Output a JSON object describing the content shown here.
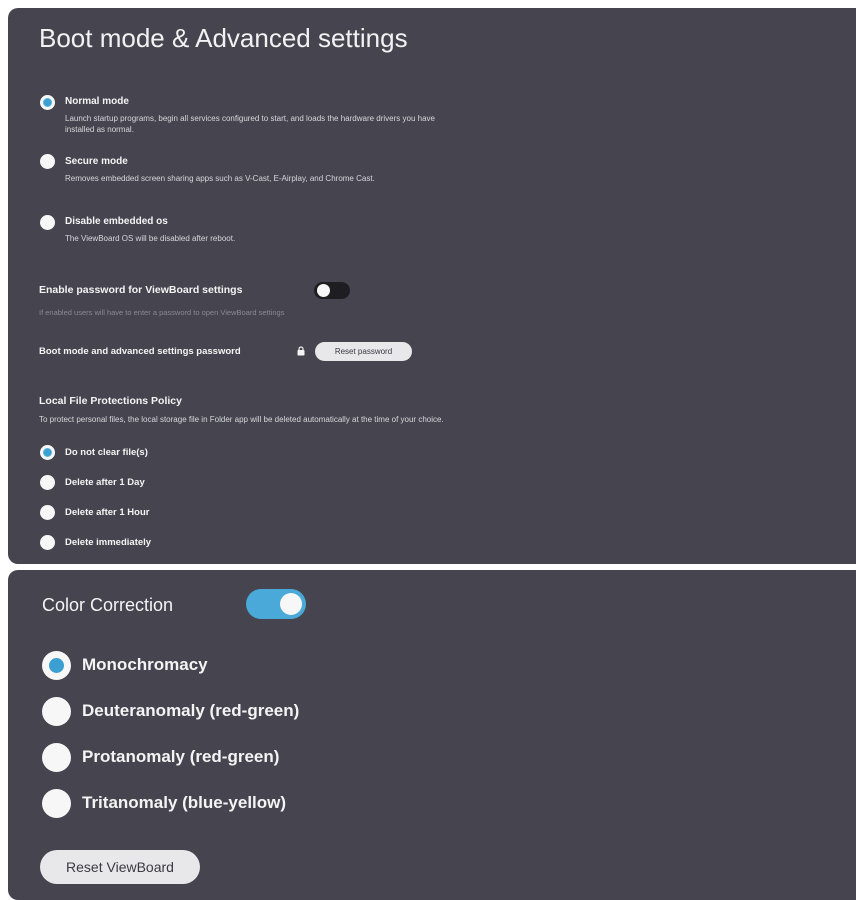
{
  "boot_panel": {
    "title": "Boot mode & Advanced settings",
    "boot_modes": [
      {
        "title": "Normal mode",
        "description": "Launch startup programs, begin all services configured to start, and loads the hardware drivers you have installed as normal.",
        "selected": true
      },
      {
        "title": "Secure mode",
        "description": "Removes embedded screen sharing apps such as V-Cast, E-Airplay, and Chrome Cast.",
        "selected": false
      },
      {
        "title": "Disable embedded os",
        "description": "The ViewBoard OS will be disabled after reboot.",
        "selected": false
      }
    ],
    "password": {
      "label": "Enable password for ViewBoard settings",
      "hint": "If enabled users will have to enter a password to open ViewBoard settings",
      "enabled": false,
      "boot_password_label": "Boot mode and advanced settings password",
      "reset_label": "Reset password",
      "lock_icon": "lock-icon"
    },
    "file_policy": {
      "title": "Local File Protections Policy",
      "description": "To protect personal files, the local storage file in Folder app will be deleted automatically at the time of your choice.",
      "options": [
        {
          "label": "Do not clear file(s)",
          "selected": true
        },
        {
          "label": "Delete after 1 Day",
          "selected": false
        },
        {
          "label": "Delete after 1 Hour",
          "selected": false
        },
        {
          "label": "Delete immediately",
          "selected": false
        }
      ]
    }
  },
  "color_panel": {
    "title": "Color Correction",
    "enabled": true,
    "options": [
      {
        "label": "Monochromacy",
        "selected": true
      },
      {
        "label": "Deuteranomaly (red-green)",
        "selected": false
      },
      {
        "label": "Protanomaly (red-green)",
        "selected": false
      },
      {
        "label": "Tritanomaly (blue-yellow)",
        "selected": false
      }
    ],
    "reset_label": "Reset ViewBoard"
  },
  "colors": {
    "panel_bg": "#46454f",
    "accent": "#4aa9d8",
    "toggle_off": "#1d1d22"
  }
}
